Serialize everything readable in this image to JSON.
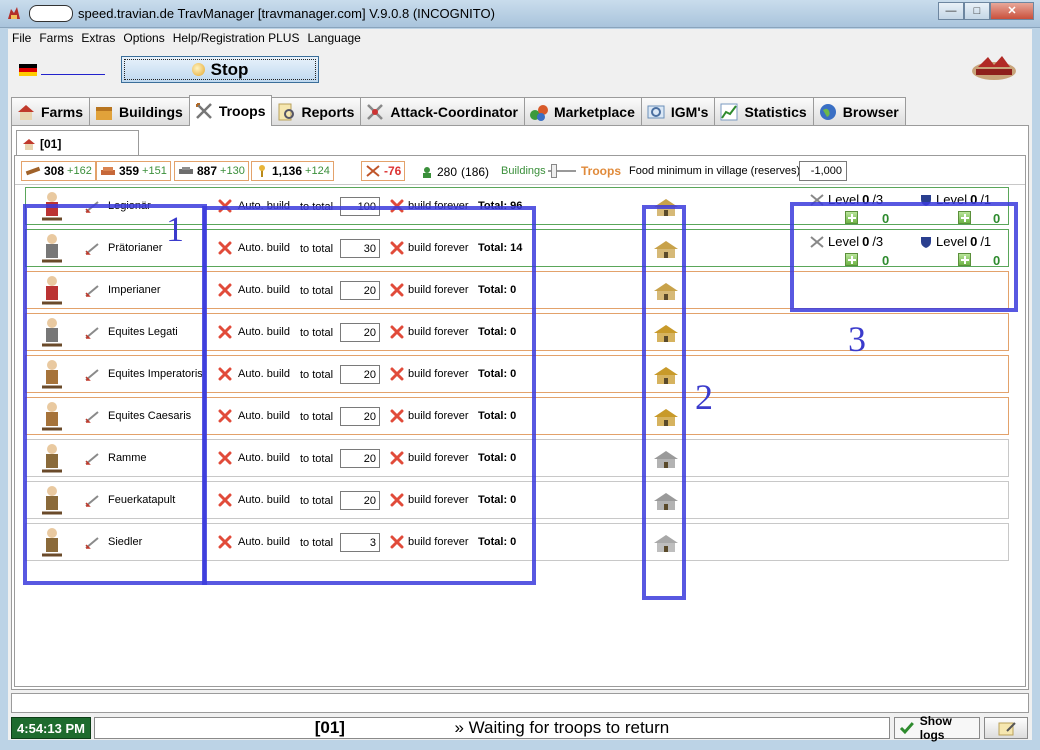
{
  "window": {
    "title": "speed.travian.de TravManager [travmanager.com] V.9.0.8 (INCOGNITO)",
    "min": "—",
    "max": "□",
    "close": "✕"
  },
  "menu": [
    "File",
    "Farms",
    "Extras",
    "Options",
    "Help/Registration PLUS",
    "Language"
  ],
  "toolbar": {
    "stop_label": "Stop"
  },
  "tabs": [
    "Farms",
    "Buildings",
    "Troops",
    "Reports",
    "Attack-Coordinator",
    "Marketplace",
    "IGM's",
    "Statistics",
    "Browser"
  ],
  "active_tab": "Troops",
  "village_tab": "[01]",
  "resources": {
    "wood": {
      "amount": "308",
      "prod": "+162"
    },
    "clay": {
      "amount": "359",
      "prod": "+151"
    },
    "iron": {
      "amount": "887",
      "prod": "+130"
    },
    "crop": {
      "amount": "1,136",
      "prod": "+124"
    },
    "net_crop": "-76",
    "population": "280",
    "population_sub": "(186)"
  },
  "toggle": {
    "left": "Buildings",
    "right": "Troops"
  },
  "food_minimum": {
    "label": "Food minimum in village (reserves)",
    "value": "-1,000"
  },
  "labels": {
    "auto_build": "Auto. build",
    "to_total": "to total",
    "build_forever": "build forever",
    "level": "Level"
  },
  "troops": [
    {
      "name": "Legionär",
      "qty": "100",
      "total": "Total: 96"
    },
    {
      "name": "Prätorianer",
      "qty": "30",
      "total": "Total: 14"
    },
    {
      "name": "Imperianer",
      "qty": "20",
      "total": "Total: 0"
    },
    {
      "name": "Equites Legati",
      "qty": "20",
      "total": "Total: 0"
    },
    {
      "name": "Equites Imperatoris",
      "qty": "20",
      "total": "Total: 0"
    },
    {
      "name": "Equites Caesaris",
      "qty": "20",
      "total": "Total: 0"
    },
    {
      "name": "Ramme",
      "qty": "20",
      "total": "Total: 0"
    },
    {
      "name": "Feuerkatapult",
      "qty": "20",
      "total": "Total: 0"
    },
    {
      "name": "Siedler",
      "qty": "3",
      "total": "Total: 0"
    }
  ],
  "upgrades": [
    {
      "atk_level": "0",
      "atk_max": "/3",
      "def_level": "0",
      "def_max": "/1",
      "atk_plus": "0",
      "def_plus": "0"
    },
    {
      "atk_level": "0",
      "atk_max": "/3",
      "def_level": "0",
      "def_max": "/1",
      "atk_plus": "0",
      "def_plus": "0"
    }
  ],
  "annotations": [
    "1",
    "2",
    "3"
  ],
  "statusbar": {
    "clock": "4:54:13 PM",
    "village": "[01]",
    "message": "» Waiting for troops to return",
    "show_logs": "Show logs"
  },
  "colors": {
    "annotation": "#3b3bdc",
    "row_green": "#5aa65a",
    "row_orange": "#e3a26b",
    "row_gray": "#c8c8c8"
  }
}
